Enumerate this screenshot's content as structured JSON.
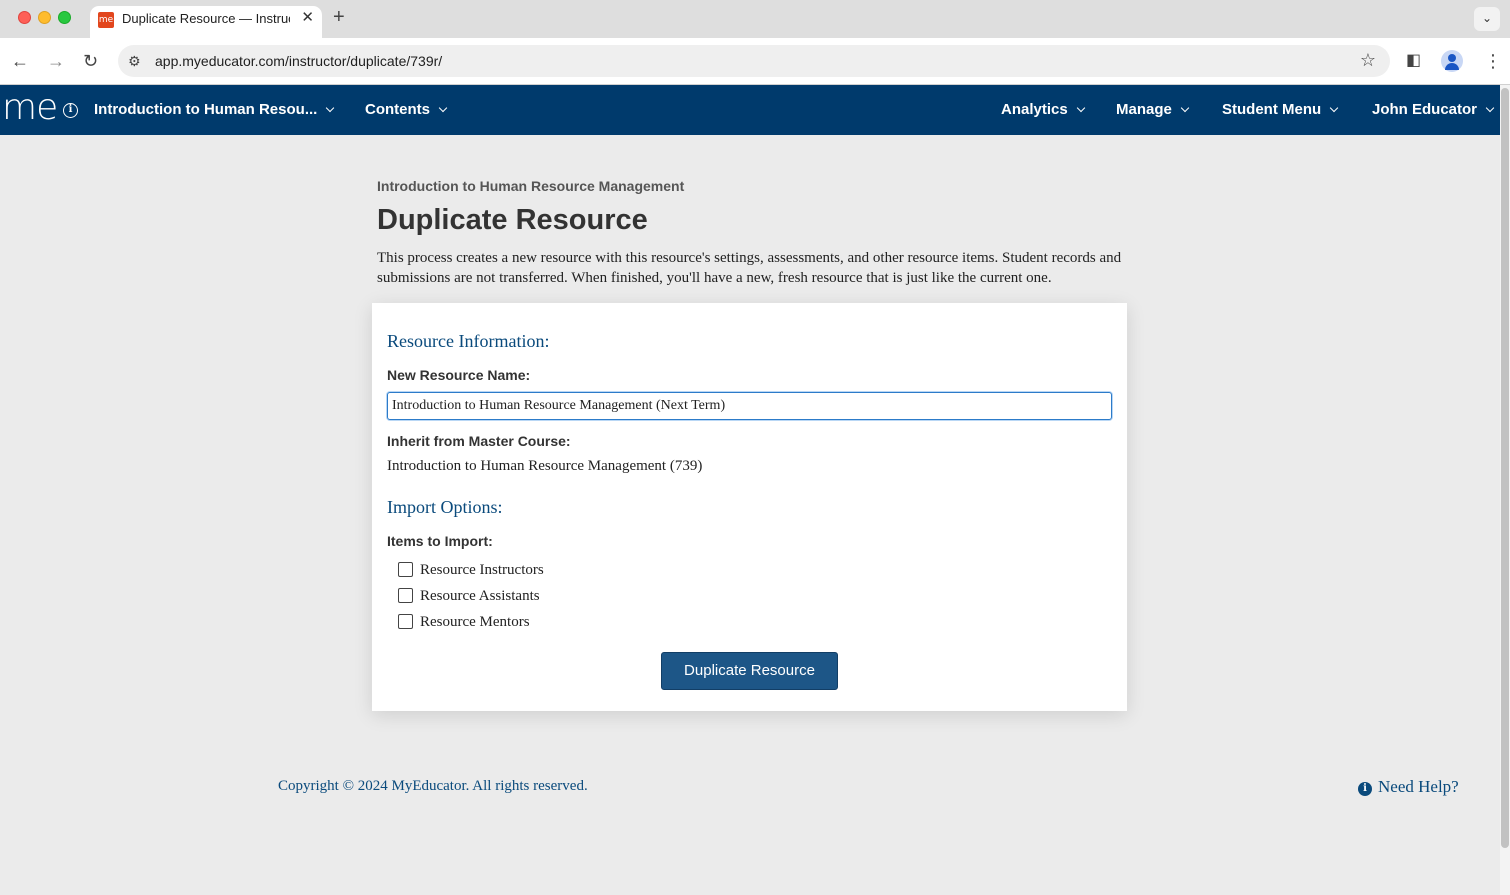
{
  "browser": {
    "tab_title": "Duplicate Resource — Instructor",
    "favicon_text": "me",
    "close_glyph": "✕",
    "new_tab_glyph": "+",
    "tab_list_glyph": "⌄",
    "back_glyph": "←",
    "forward_glyph": "→",
    "reload_glyph": "↻",
    "site_info_glyph": "⚙",
    "star_glyph": "☆",
    "sidepanel_glyph": "◧",
    "menu_glyph": "⋮",
    "url": "app.myeducator.com/instructor/duplicate/739r/"
  },
  "nav": {
    "logo": "me",
    "info_glyph": "i",
    "course_menu": "Introduction to Human Resou...",
    "contents_menu": "Contents",
    "analytics_menu": "Analytics",
    "manage_menu": "Manage",
    "student_menu": "Student Menu",
    "user_menu": "John Educator"
  },
  "page": {
    "course_name": "Introduction to Human Resource Management",
    "title": "Duplicate Resource",
    "description": "This process creates a new resource with this resource's settings, assessments, and other resource items. Student records and submissions are not transferred. When finished, you'll have a new, fresh resource that is just like the current one."
  },
  "form": {
    "resource_info_heading": "Resource Information:",
    "new_name_label": "New Resource Name:",
    "new_name_value": "Introduction to Human Resource Management (Next Term)",
    "master_course_label": "Inherit from Master Course:",
    "master_course_value": "Introduction to Human Resource Management (739)",
    "import_options_heading": "Import Options:",
    "items_label": "Items to Import:",
    "items": [
      {
        "label": "Resource Instructors",
        "checked": false
      },
      {
        "label": "Resource Assistants",
        "checked": false
      },
      {
        "label": "Resource Mentors",
        "checked": false
      }
    ],
    "submit_label": "Duplicate Resource"
  },
  "footer": {
    "copyright": "Copyright © 2024 MyEducator. All rights reserved.",
    "help_glyph": "i",
    "help_label": "Need Help?"
  },
  "colors": {
    "nav_bg": "#003a6c",
    "accent_text": "#0a4a7c",
    "button_bg": "#1d5687",
    "page_bg": "#ebebeb"
  }
}
